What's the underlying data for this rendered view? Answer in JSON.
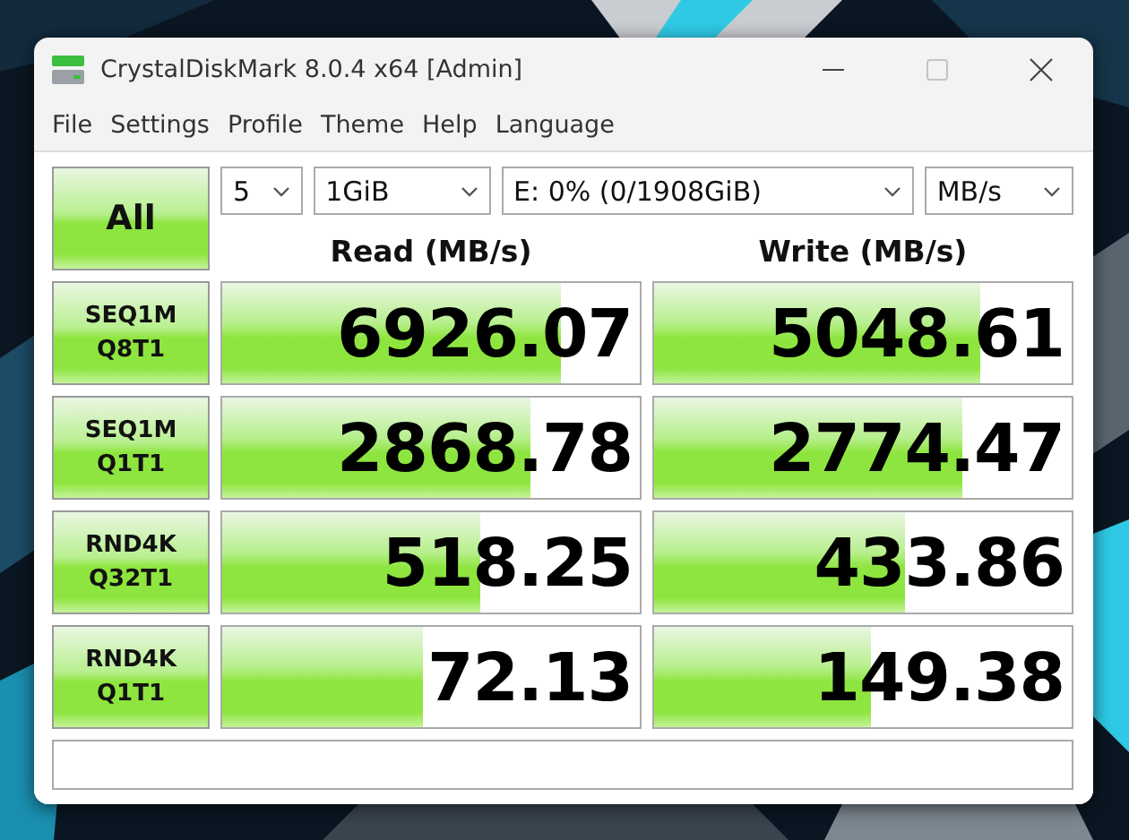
{
  "window": {
    "title": "CrystalDiskMark 8.0.4 x64 [Admin]"
  },
  "menu": [
    "File",
    "Settings",
    "Profile",
    "Theme",
    "Help",
    "Language"
  ],
  "all_button": {
    "label": "All"
  },
  "dropdowns": [
    {
      "value": "5"
    },
    {
      "value": "1GiB"
    },
    {
      "value": "E: 0% (0/1908GiB)"
    },
    {
      "value": "MB/s"
    }
  ],
  "columns": [
    "Read (MB/s)",
    "Write (MB/s)"
  ],
  "tests": [
    {
      "name": "SEQ1M",
      "queue": "Q8T1",
      "read": {
        "value": "6926.07",
        "level": 0.81
      },
      "write": {
        "value": "5048.61",
        "level": 0.78
      }
    },
    {
      "name": "SEQ1M",
      "queue": "Q1T1",
      "read": {
        "value": "2868.78",
        "level": 0.74
      },
      "write": {
        "value": "2774.47",
        "level": 0.74
      }
    },
    {
      "name": "RND4K",
      "queue": "Q32T1",
      "read": {
        "value": "518.25",
        "level": 0.62
      },
      "write": {
        "value": "433.86",
        "level": 0.6
      }
    },
    {
      "name": "RND4K",
      "queue": "Q1T1",
      "read": {
        "value": "72.13",
        "level": 0.48
      },
      "write": {
        "value": "149.38",
        "level": 0.52
      }
    }
  ]
}
